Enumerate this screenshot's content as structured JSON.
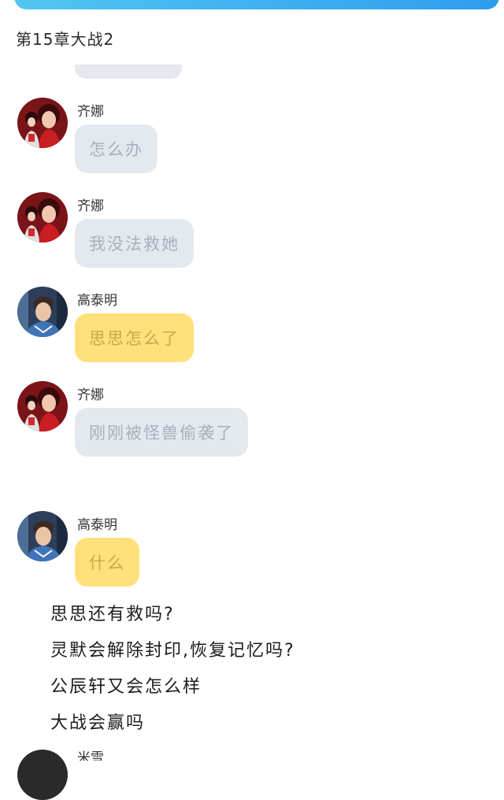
{
  "chapter_title": "第15章大战2",
  "messages": [
    {
      "sender": "齐娜",
      "text": "怎么办",
      "avatar": "qina-avatar",
      "bubble_style": "gray"
    },
    {
      "sender": "齐娜",
      "text": "我没法救她",
      "avatar": "qina-avatar",
      "bubble_style": "gray"
    },
    {
      "sender": "高泰明",
      "text": "思思怎么了",
      "avatar": "gaotaiming-avatar",
      "bubble_style": "yellow"
    },
    {
      "sender": "齐娜",
      "text": "刚刚被怪兽偷袭了",
      "avatar": "qina-avatar",
      "bubble_style": "gray"
    },
    {
      "sender": "高泰明",
      "text": "什么",
      "avatar": "gaotaiming-avatar",
      "bubble_style": "yellow"
    }
  ],
  "commentary": [
    "思思还有救吗?",
    "灵默会解除封印,恢复记忆吗?",
    "公辰轩又会怎么样",
    "大战会赢吗"
  ],
  "partial_sender": "米雪",
  "colors": {
    "header_gradient_start": "#52c6f2",
    "header_gradient_end": "#2f9cf0",
    "gray_bubble": "#e4e8ef",
    "yellow_bubble": "#ffe07a"
  }
}
